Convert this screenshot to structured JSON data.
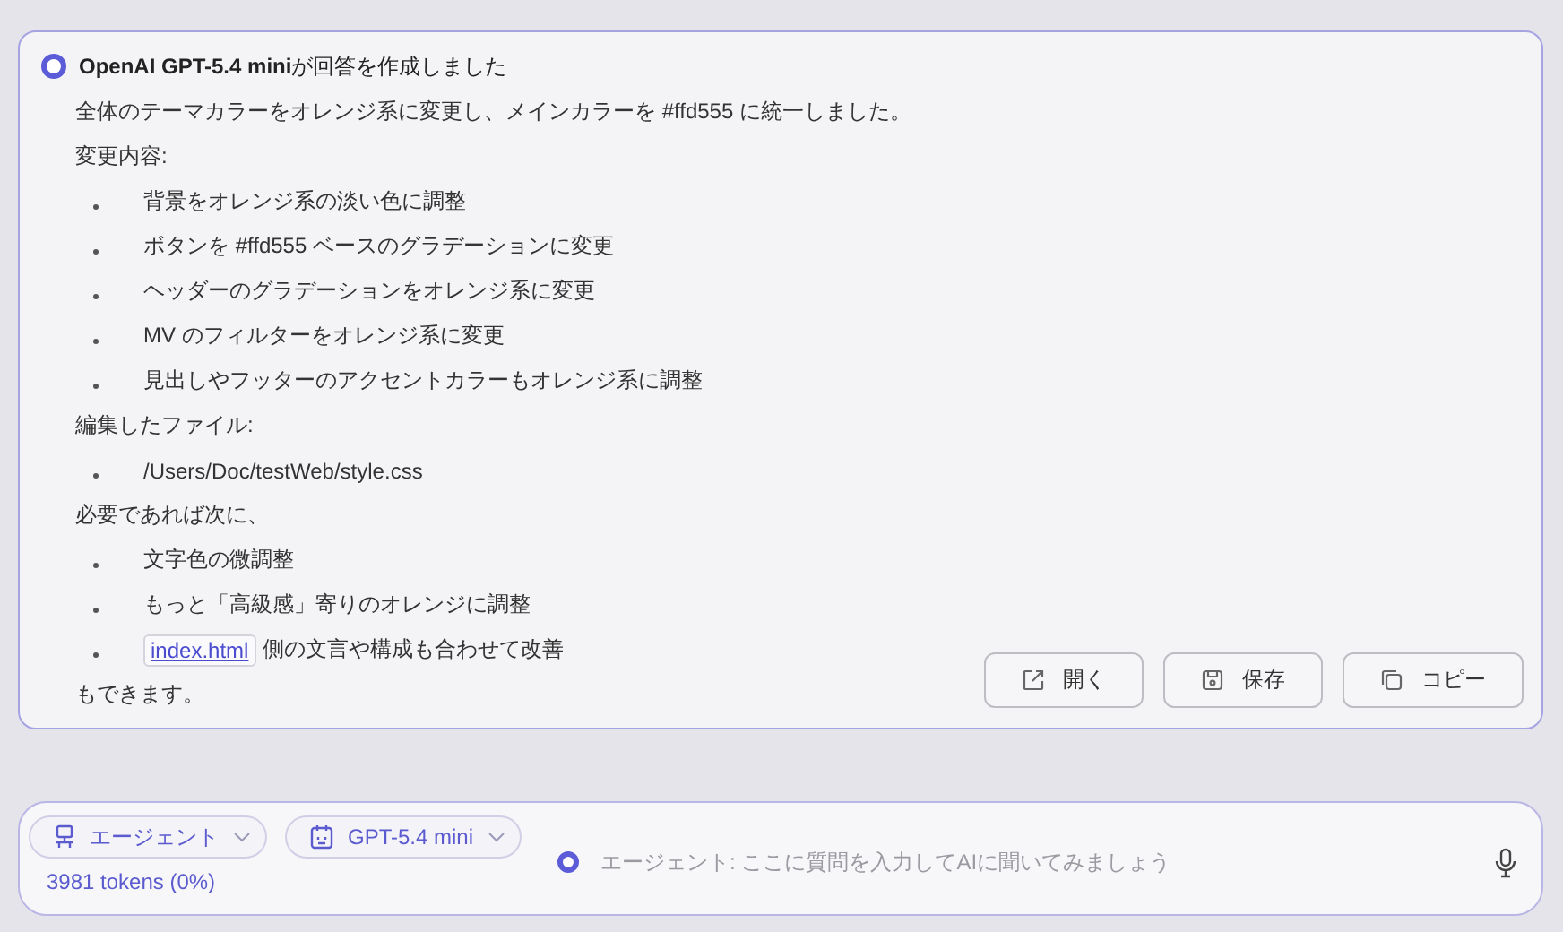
{
  "message": {
    "title": "OpenAI GPT-5.4 mini",
    "title_suffix": "が回答を作成しました",
    "blocks": [
      {
        "kind": "paragraph",
        "text": "全体のテーマカラーをオレンジ系に変更し、メインカラーを #ffd555 に統一しました。"
      },
      {
        "kind": "paragraph",
        "text": "変更内容:"
      },
      {
        "kind": "list",
        "items": [
          {
            "text": "背景をオレンジ系の淡い色に調整"
          },
          {
            "text": "ボタンを #ffd555 ベースのグラデーションに変更"
          },
          {
            "text": "ヘッダーのグラデーションをオレンジ系に変更"
          },
          {
            "text": "MV のフィルターをオレンジ系に変更"
          },
          {
            "text": "見出しやフッターのアクセントカラーもオレンジ系に調整"
          }
        ]
      },
      {
        "kind": "paragraph",
        "text": "編集したファイル:"
      },
      {
        "kind": "list",
        "items": [
          {
            "text": "/Users/Doc/testWeb/style.css"
          }
        ]
      },
      {
        "kind": "paragraph",
        "text": "必要であれば次に、"
      },
      {
        "kind": "list",
        "items": [
          {
            "text": "文字色の微調整"
          },
          {
            "text": "もっと「高級感」寄りのオレンジに調整"
          },
          {
            "code": "index.html",
            "text": "側の文言や構成も合わせて改善"
          }
        ]
      },
      {
        "kind": "paragraph",
        "text": "もできます。"
      }
    ],
    "actions": [
      {
        "kind": "open",
        "label": "開く"
      },
      {
        "kind": "save",
        "label": "保存"
      },
      {
        "kind": "copy",
        "label": "コピー"
      }
    ]
  },
  "composer": {
    "mode": "エージェント",
    "model": "GPT-5.4 mini",
    "tokens": "3981 tokens (0%)",
    "placeholder": "エージェント: ここに質問を入力してAIに聞いてみましょう"
  }
}
